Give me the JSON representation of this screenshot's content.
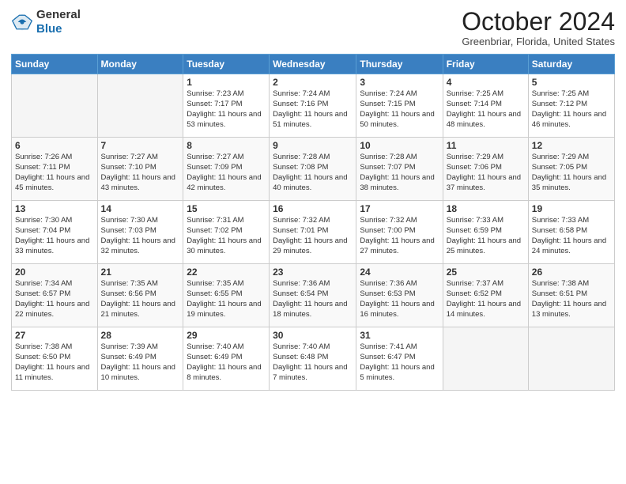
{
  "header": {
    "logo_line1": "General",
    "logo_line2": "Blue",
    "month_title": "October 2024",
    "location": "Greenbriar, Florida, United States"
  },
  "weekdays": [
    "Sunday",
    "Monday",
    "Tuesday",
    "Wednesday",
    "Thursday",
    "Friday",
    "Saturday"
  ],
  "weeks": [
    [
      {
        "day": "",
        "sunrise": "",
        "sunset": "",
        "daylight": ""
      },
      {
        "day": "",
        "sunrise": "",
        "sunset": "",
        "daylight": ""
      },
      {
        "day": "1",
        "sunrise": "Sunrise: 7:23 AM",
        "sunset": "Sunset: 7:17 PM",
        "daylight": "Daylight: 11 hours and 53 minutes."
      },
      {
        "day": "2",
        "sunrise": "Sunrise: 7:24 AM",
        "sunset": "Sunset: 7:16 PM",
        "daylight": "Daylight: 11 hours and 51 minutes."
      },
      {
        "day": "3",
        "sunrise": "Sunrise: 7:24 AM",
        "sunset": "Sunset: 7:15 PM",
        "daylight": "Daylight: 11 hours and 50 minutes."
      },
      {
        "day": "4",
        "sunrise": "Sunrise: 7:25 AM",
        "sunset": "Sunset: 7:14 PM",
        "daylight": "Daylight: 11 hours and 48 minutes."
      },
      {
        "day": "5",
        "sunrise": "Sunrise: 7:25 AM",
        "sunset": "Sunset: 7:12 PM",
        "daylight": "Daylight: 11 hours and 46 minutes."
      }
    ],
    [
      {
        "day": "6",
        "sunrise": "Sunrise: 7:26 AM",
        "sunset": "Sunset: 7:11 PM",
        "daylight": "Daylight: 11 hours and 45 minutes."
      },
      {
        "day": "7",
        "sunrise": "Sunrise: 7:27 AM",
        "sunset": "Sunset: 7:10 PM",
        "daylight": "Daylight: 11 hours and 43 minutes."
      },
      {
        "day": "8",
        "sunrise": "Sunrise: 7:27 AM",
        "sunset": "Sunset: 7:09 PM",
        "daylight": "Daylight: 11 hours and 42 minutes."
      },
      {
        "day": "9",
        "sunrise": "Sunrise: 7:28 AM",
        "sunset": "Sunset: 7:08 PM",
        "daylight": "Daylight: 11 hours and 40 minutes."
      },
      {
        "day": "10",
        "sunrise": "Sunrise: 7:28 AM",
        "sunset": "Sunset: 7:07 PM",
        "daylight": "Daylight: 11 hours and 38 minutes."
      },
      {
        "day": "11",
        "sunrise": "Sunrise: 7:29 AM",
        "sunset": "Sunset: 7:06 PM",
        "daylight": "Daylight: 11 hours and 37 minutes."
      },
      {
        "day": "12",
        "sunrise": "Sunrise: 7:29 AM",
        "sunset": "Sunset: 7:05 PM",
        "daylight": "Daylight: 11 hours and 35 minutes."
      }
    ],
    [
      {
        "day": "13",
        "sunrise": "Sunrise: 7:30 AM",
        "sunset": "Sunset: 7:04 PM",
        "daylight": "Daylight: 11 hours and 33 minutes."
      },
      {
        "day": "14",
        "sunrise": "Sunrise: 7:30 AM",
        "sunset": "Sunset: 7:03 PM",
        "daylight": "Daylight: 11 hours and 32 minutes."
      },
      {
        "day": "15",
        "sunrise": "Sunrise: 7:31 AM",
        "sunset": "Sunset: 7:02 PM",
        "daylight": "Daylight: 11 hours and 30 minutes."
      },
      {
        "day": "16",
        "sunrise": "Sunrise: 7:32 AM",
        "sunset": "Sunset: 7:01 PM",
        "daylight": "Daylight: 11 hours and 29 minutes."
      },
      {
        "day": "17",
        "sunrise": "Sunrise: 7:32 AM",
        "sunset": "Sunset: 7:00 PM",
        "daylight": "Daylight: 11 hours and 27 minutes."
      },
      {
        "day": "18",
        "sunrise": "Sunrise: 7:33 AM",
        "sunset": "Sunset: 6:59 PM",
        "daylight": "Daylight: 11 hours and 25 minutes."
      },
      {
        "day": "19",
        "sunrise": "Sunrise: 7:33 AM",
        "sunset": "Sunset: 6:58 PM",
        "daylight": "Daylight: 11 hours and 24 minutes."
      }
    ],
    [
      {
        "day": "20",
        "sunrise": "Sunrise: 7:34 AM",
        "sunset": "Sunset: 6:57 PM",
        "daylight": "Daylight: 11 hours and 22 minutes."
      },
      {
        "day": "21",
        "sunrise": "Sunrise: 7:35 AM",
        "sunset": "Sunset: 6:56 PM",
        "daylight": "Daylight: 11 hours and 21 minutes."
      },
      {
        "day": "22",
        "sunrise": "Sunrise: 7:35 AM",
        "sunset": "Sunset: 6:55 PM",
        "daylight": "Daylight: 11 hours and 19 minutes."
      },
      {
        "day": "23",
        "sunrise": "Sunrise: 7:36 AM",
        "sunset": "Sunset: 6:54 PM",
        "daylight": "Daylight: 11 hours and 18 minutes."
      },
      {
        "day": "24",
        "sunrise": "Sunrise: 7:36 AM",
        "sunset": "Sunset: 6:53 PM",
        "daylight": "Daylight: 11 hours and 16 minutes."
      },
      {
        "day": "25",
        "sunrise": "Sunrise: 7:37 AM",
        "sunset": "Sunset: 6:52 PM",
        "daylight": "Daylight: 11 hours and 14 minutes."
      },
      {
        "day": "26",
        "sunrise": "Sunrise: 7:38 AM",
        "sunset": "Sunset: 6:51 PM",
        "daylight": "Daylight: 11 hours and 13 minutes."
      }
    ],
    [
      {
        "day": "27",
        "sunrise": "Sunrise: 7:38 AM",
        "sunset": "Sunset: 6:50 PM",
        "daylight": "Daylight: 11 hours and 11 minutes."
      },
      {
        "day": "28",
        "sunrise": "Sunrise: 7:39 AM",
        "sunset": "Sunset: 6:49 PM",
        "daylight": "Daylight: 11 hours and 10 minutes."
      },
      {
        "day": "29",
        "sunrise": "Sunrise: 7:40 AM",
        "sunset": "Sunset: 6:49 PM",
        "daylight": "Daylight: 11 hours and 8 minutes."
      },
      {
        "day": "30",
        "sunrise": "Sunrise: 7:40 AM",
        "sunset": "Sunset: 6:48 PM",
        "daylight": "Daylight: 11 hours and 7 minutes."
      },
      {
        "day": "31",
        "sunrise": "Sunrise: 7:41 AM",
        "sunset": "Sunset: 6:47 PM",
        "daylight": "Daylight: 11 hours and 5 minutes."
      },
      {
        "day": "",
        "sunrise": "",
        "sunset": "",
        "daylight": ""
      },
      {
        "day": "",
        "sunrise": "",
        "sunset": "",
        "daylight": ""
      }
    ]
  ]
}
